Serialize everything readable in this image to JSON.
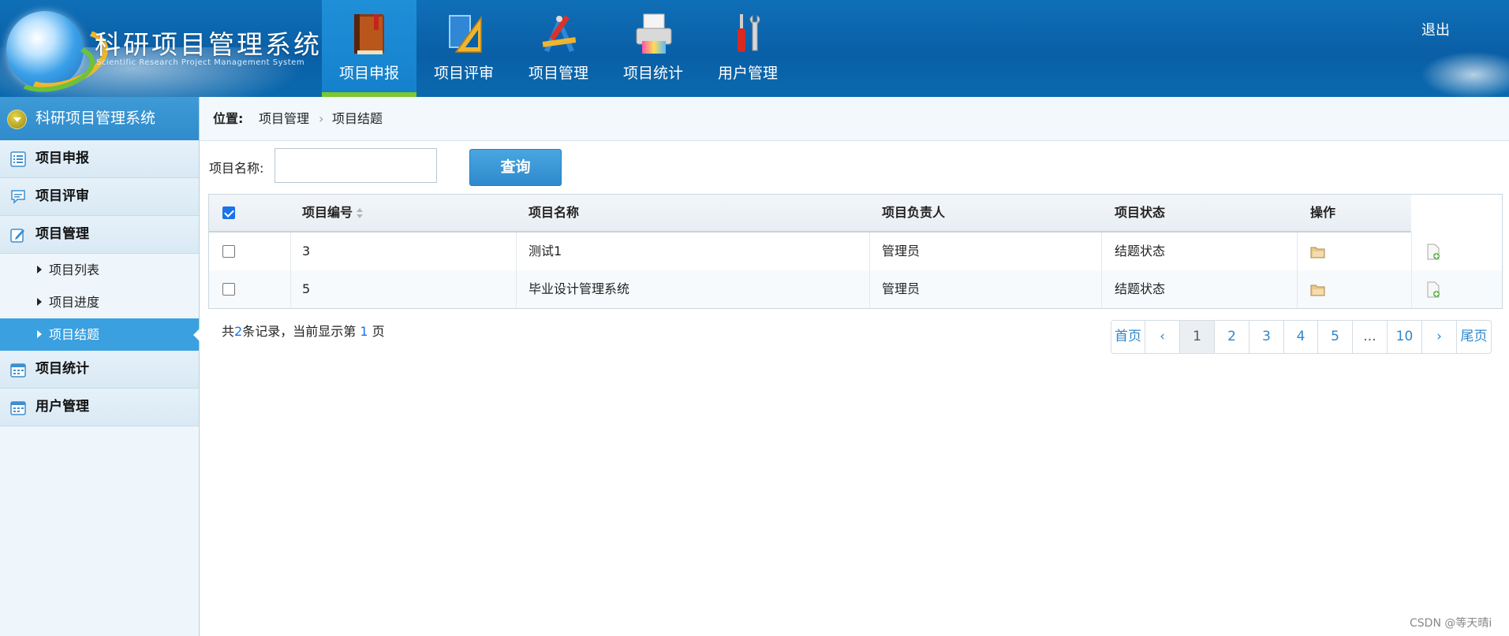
{
  "header": {
    "title": "科研项目管理系统",
    "subtitle": "Scientific Research Project Management System",
    "nav": [
      {
        "label": "项目申报",
        "icon": "book-icon",
        "active": true
      },
      {
        "label": "项目评审",
        "icon": "ruler-icon",
        "active": false
      },
      {
        "label": "项目管理",
        "icon": "design-tools-icon",
        "active": false
      },
      {
        "label": "项目统计",
        "icon": "printer-icon",
        "active": false
      },
      {
        "label": "用户管理",
        "icon": "tools-icon",
        "active": false
      }
    ],
    "logout": "退出"
  },
  "sidebar": {
    "title": "科研项目管理系统",
    "groups": [
      {
        "label": "项目申报",
        "icon": "list-icon"
      },
      {
        "label": "项目评审",
        "icon": "comment-icon"
      },
      {
        "label": "项目管理",
        "icon": "edit-icon",
        "items": [
          "项目列表",
          "项目进度",
          "项目结题"
        ],
        "active_item": "项目结题"
      },
      {
        "label": "项目统计",
        "icon": "calendar-icon"
      },
      {
        "label": "用户管理",
        "icon": "calendar-icon"
      }
    ]
  },
  "breadcrumb": {
    "label": "位置:",
    "items": [
      "项目管理",
      "项目结题"
    ],
    "separator": "›"
  },
  "search": {
    "label": "项目名称:",
    "value": "",
    "button": "查询"
  },
  "table": {
    "columns": [
      "项目编号",
      "项目名称",
      "项目负责人",
      "项目状态",
      "操作"
    ],
    "header_checked": true,
    "rows": [
      {
        "checked": false,
        "id": "3",
        "name": "测试1",
        "owner": "管理员",
        "status": "结题状态"
      },
      {
        "checked": false,
        "id": "5",
        "name": "毕业设计管理系统",
        "owner": "管理员",
        "status": "结题状态"
      }
    ]
  },
  "summary": {
    "prefix": "共",
    "total": "2",
    "middle": "条记录，当前显示第",
    "page": "1",
    "suffix": "页"
  },
  "pager": {
    "first": "首页",
    "prev": "‹",
    "pages": [
      "1",
      "2",
      "3",
      "4",
      "5"
    ],
    "current": "1",
    "dots": "...",
    "last_page": "10",
    "next": "›",
    "last": "尾页"
  },
  "watermark": "CSDN @等天晴i",
  "colors": {
    "header_bg": "#0a5fa6",
    "accent": "#3aa0df",
    "active_nav_border": "#7dc72e",
    "link": "#2e86cc"
  }
}
